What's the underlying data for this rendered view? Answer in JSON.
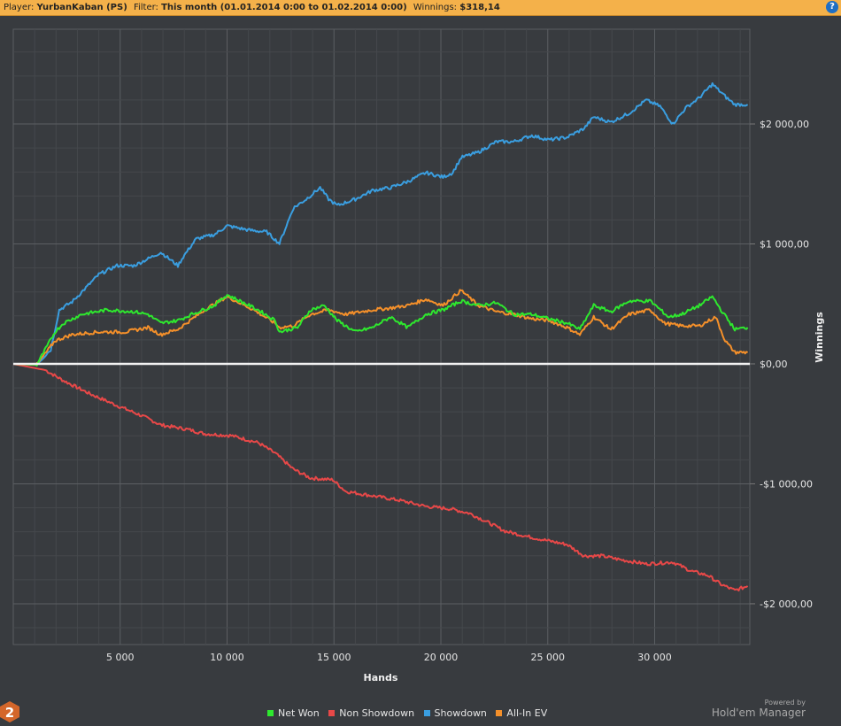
{
  "header": {
    "player_label": "Player:",
    "player_value": "YurbanKaban (PS)",
    "filter_label": "Filter:",
    "filter_value": "This month (01.01.2014 0:00 to 01.02.2014 0:00)",
    "winnings_label": "Winnings:",
    "winnings_value": "$318,14",
    "help_icon": "?"
  },
  "branding": {
    "powered_by": "Powered by",
    "product": "Hold'em Manager",
    "logo_text": "2"
  },
  "chart_data": {
    "type": "line",
    "title": "",
    "xlabel": "Hands",
    "ylabel": "Winnings",
    "xlim": [
      0,
      34450
    ],
    "ylim": [
      -2340,
      2790
    ],
    "grid": true,
    "legend_position": "bottom-center",
    "x_ticks": [
      {
        "value": 5000,
        "label": "5 000"
      },
      {
        "value": 10000,
        "label": "10 000"
      },
      {
        "value": 15000,
        "label": "15 000"
      },
      {
        "value": 20000,
        "label": "20 000"
      },
      {
        "value": 25000,
        "label": "25 000"
      },
      {
        "value": 30000,
        "label": "30 000"
      }
    ],
    "y_ticks": [
      {
        "value": 2000,
        "label": "$2 000,00"
      },
      {
        "value": 1000,
        "label": "$1 000,00"
      },
      {
        "value": 0,
        "label": "$0,00"
      },
      {
        "value": -1000,
        "label": "-$1 000,00"
      },
      {
        "value": -2000,
        "label": "-$2 000,00"
      }
    ],
    "series": [
      {
        "name": "Net Won",
        "color": "#2ee82e",
        "points": [
          [
            0,
            0
          ],
          [
            1100,
            -7
          ],
          [
            1950,
            266
          ],
          [
            2350,
            339
          ],
          [
            3200,
            413
          ],
          [
            4400,
            450
          ],
          [
            5650,
            435
          ],
          [
            6300,
            413
          ],
          [
            6900,
            339
          ],
          [
            7700,
            362
          ],
          [
            8350,
            413
          ],
          [
            9400,
            487
          ],
          [
            10000,
            576
          ],
          [
            10600,
            524
          ],
          [
            11450,
            450
          ],
          [
            12250,
            362
          ],
          [
            12450,
            266
          ],
          [
            13300,
            303
          ],
          [
            13900,
            450
          ],
          [
            14550,
            487
          ],
          [
            15150,
            362
          ],
          [
            16000,
            266
          ],
          [
            16800,
            303
          ],
          [
            17650,
            391
          ],
          [
            18450,
            303
          ],
          [
            19300,
            413
          ],
          [
            20100,
            450
          ],
          [
            20950,
            524
          ],
          [
            21750,
            487
          ],
          [
            22600,
            509
          ],
          [
            23400,
            413
          ],
          [
            24250,
            413
          ],
          [
            25050,
            376
          ],
          [
            25900,
            339
          ],
          [
            26500,
            288
          ],
          [
            27150,
            487
          ],
          [
            27950,
            435
          ],
          [
            28800,
            524
          ],
          [
            29800,
            524
          ],
          [
            30650,
            391
          ],
          [
            31250,
            413
          ],
          [
            32100,
            487
          ],
          [
            32700,
            561
          ],
          [
            33100,
            450
          ],
          [
            33750,
            288
          ],
          [
            34350,
            303
          ]
        ]
      },
      {
        "name": "Non Showdown",
        "color": "#e84848",
        "points": [
          [
            0,
            0
          ],
          [
            1500,
            -52
          ],
          [
            2350,
            -140
          ],
          [
            3600,
            -251
          ],
          [
            4850,
            -347
          ],
          [
            6050,
            -435
          ],
          [
            6900,
            -509
          ],
          [
            8150,
            -546
          ],
          [
            8950,
            -583
          ],
          [
            10200,
            -598
          ],
          [
            11450,
            -657
          ],
          [
            12250,
            -745
          ],
          [
            13100,
            -878
          ],
          [
            13900,
            -952
          ],
          [
            14950,
            -967
          ],
          [
            15550,
            -1063
          ],
          [
            16800,
            -1100
          ],
          [
            18050,
            -1137
          ],
          [
            19300,
            -1188
          ],
          [
            20500,
            -1210
          ],
          [
            21350,
            -1247
          ],
          [
            22200,
            -1321
          ],
          [
            23000,
            -1395
          ],
          [
            24250,
            -1447
          ],
          [
            25900,
            -1506
          ],
          [
            26700,
            -1601
          ],
          [
            27550,
            -1601
          ],
          [
            28350,
            -1631
          ],
          [
            29600,
            -1668
          ],
          [
            30850,
            -1653
          ],
          [
            31700,
            -1727
          ],
          [
            32500,
            -1764
          ],
          [
            33100,
            -1838
          ],
          [
            33750,
            -1889
          ],
          [
            34350,
            -1852
          ]
        ]
      },
      {
        "name": "Showdown",
        "color": "#3a9ee0",
        "points": [
          [
            0,
            0
          ],
          [
            1100,
            0
          ],
          [
            1750,
            118
          ],
          [
            2150,
            450
          ],
          [
            2750,
            517
          ],
          [
            3400,
            635
          ],
          [
            4000,
            745
          ],
          [
            4850,
            819
          ],
          [
            5650,
            819
          ],
          [
            6500,
            893
          ],
          [
            6900,
            930
          ],
          [
            7700,
            819
          ],
          [
            7950,
            893
          ],
          [
            8550,
            1041
          ],
          [
            9400,
            1077
          ],
          [
            10000,
            1151
          ],
          [
            11050,
            1114
          ],
          [
            11850,
            1100
          ],
          [
            12450,
            1004
          ],
          [
            13100,
            1299
          ],
          [
            13700,
            1373
          ],
          [
            14350,
            1469
          ],
          [
            14750,
            1373
          ],
          [
            15150,
            1321
          ],
          [
            16000,
            1373
          ],
          [
            16800,
            1446
          ],
          [
            17650,
            1469
          ],
          [
            18450,
            1520
          ],
          [
            19300,
            1594
          ],
          [
            20100,
            1557
          ],
          [
            20550,
            1594
          ],
          [
            20950,
            1720
          ],
          [
            21750,
            1764
          ],
          [
            22600,
            1852
          ],
          [
            23400,
            1852
          ],
          [
            24250,
            1904
          ],
          [
            25050,
            1867
          ],
          [
            25900,
            1889
          ],
          [
            26700,
            1963
          ],
          [
            27150,
            2059
          ],
          [
            27950,
            2015
          ],
          [
            28800,
            2089
          ],
          [
            29600,
            2199
          ],
          [
            30250,
            2148
          ],
          [
            30850,
            2000
          ],
          [
            31450,
            2133
          ],
          [
            32100,
            2221
          ],
          [
            32700,
            2332
          ],
          [
            33350,
            2221
          ],
          [
            33750,
            2162
          ],
          [
            34350,
            2162
          ]
        ]
      },
      {
        "name": "All-In EV",
        "color": "#f5902a",
        "points": [
          [
            0,
            0
          ],
          [
            1100,
            -7
          ],
          [
            1950,
            192
          ],
          [
            2750,
            244
          ],
          [
            4000,
            266
          ],
          [
            5250,
            266
          ],
          [
            6300,
            303
          ],
          [
            6900,
            244
          ],
          [
            7700,
            288
          ],
          [
            8950,
            450
          ],
          [
            10000,
            561
          ],
          [
            11250,
            450
          ],
          [
            12250,
            339
          ],
          [
            12450,
            303
          ],
          [
            13100,
            317
          ],
          [
            13900,
            413
          ],
          [
            14750,
            450
          ],
          [
            15550,
            413
          ],
          [
            16800,
            450
          ],
          [
            17650,
            465
          ],
          [
            18450,
            487
          ],
          [
            19300,
            539
          ],
          [
            20100,
            487
          ],
          [
            20950,
            613
          ],
          [
            21750,
            487
          ],
          [
            22600,
            435
          ],
          [
            23400,
            413
          ],
          [
            24250,
            376
          ],
          [
            25050,
            362
          ],
          [
            25900,
            303
          ],
          [
            26500,
            244
          ],
          [
            27150,
            391
          ],
          [
            27950,
            288
          ],
          [
            28800,
            413
          ],
          [
            29800,
            450
          ],
          [
            30450,
            339
          ],
          [
            31250,
            317
          ],
          [
            32100,
            317
          ],
          [
            32850,
            391
          ],
          [
            33300,
            192
          ],
          [
            33750,
            96
          ],
          [
            34350,
            96
          ]
        ]
      }
    ]
  }
}
